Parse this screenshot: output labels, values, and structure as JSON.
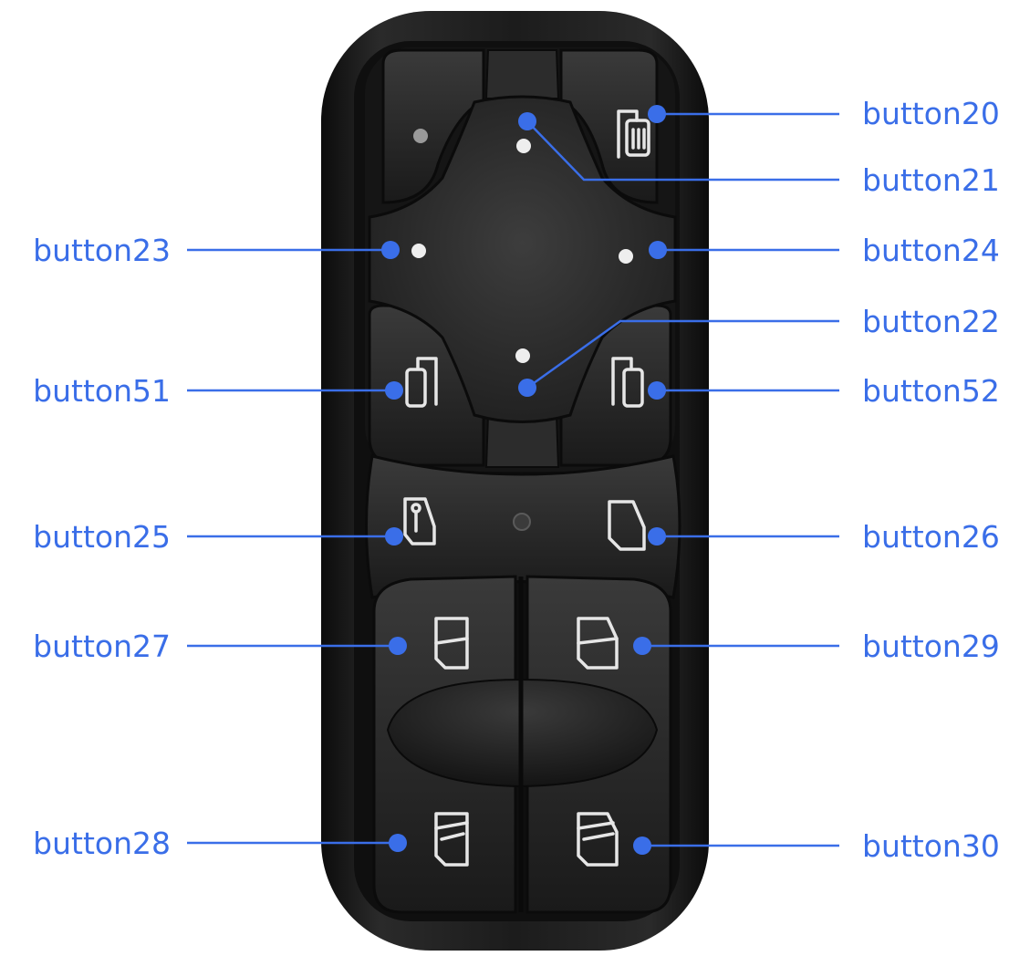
{
  "colors": {
    "accent": "#3a6ee8",
    "housing": "#1c1c1c",
    "button": "#2a2a2a",
    "button_dark": "#141414",
    "symbol": "#e6e6e6",
    "led": "#eeeeee"
  },
  "labels": {
    "b20": "button20",
    "b21": "button21",
    "b22": "button22",
    "b23": "button23",
    "b24": "button24",
    "b25": "button25",
    "b26": "button26",
    "b27": "button27",
    "b28": "button28",
    "b29": "button29",
    "b30": "button30",
    "b51": "button51",
    "b52": "button52"
  },
  "icons": {
    "b20": "mirror-heat-icon",
    "b25": "door-lock-icon",
    "b26": "door-icon",
    "b27": "window-up-left-icon",
    "b28": "window-down-left-icon",
    "b29": "window-up-right-icon",
    "b30": "window-down-right-icon",
    "b51": "mirror-left-icon",
    "b52": "mirror-right-icon"
  }
}
